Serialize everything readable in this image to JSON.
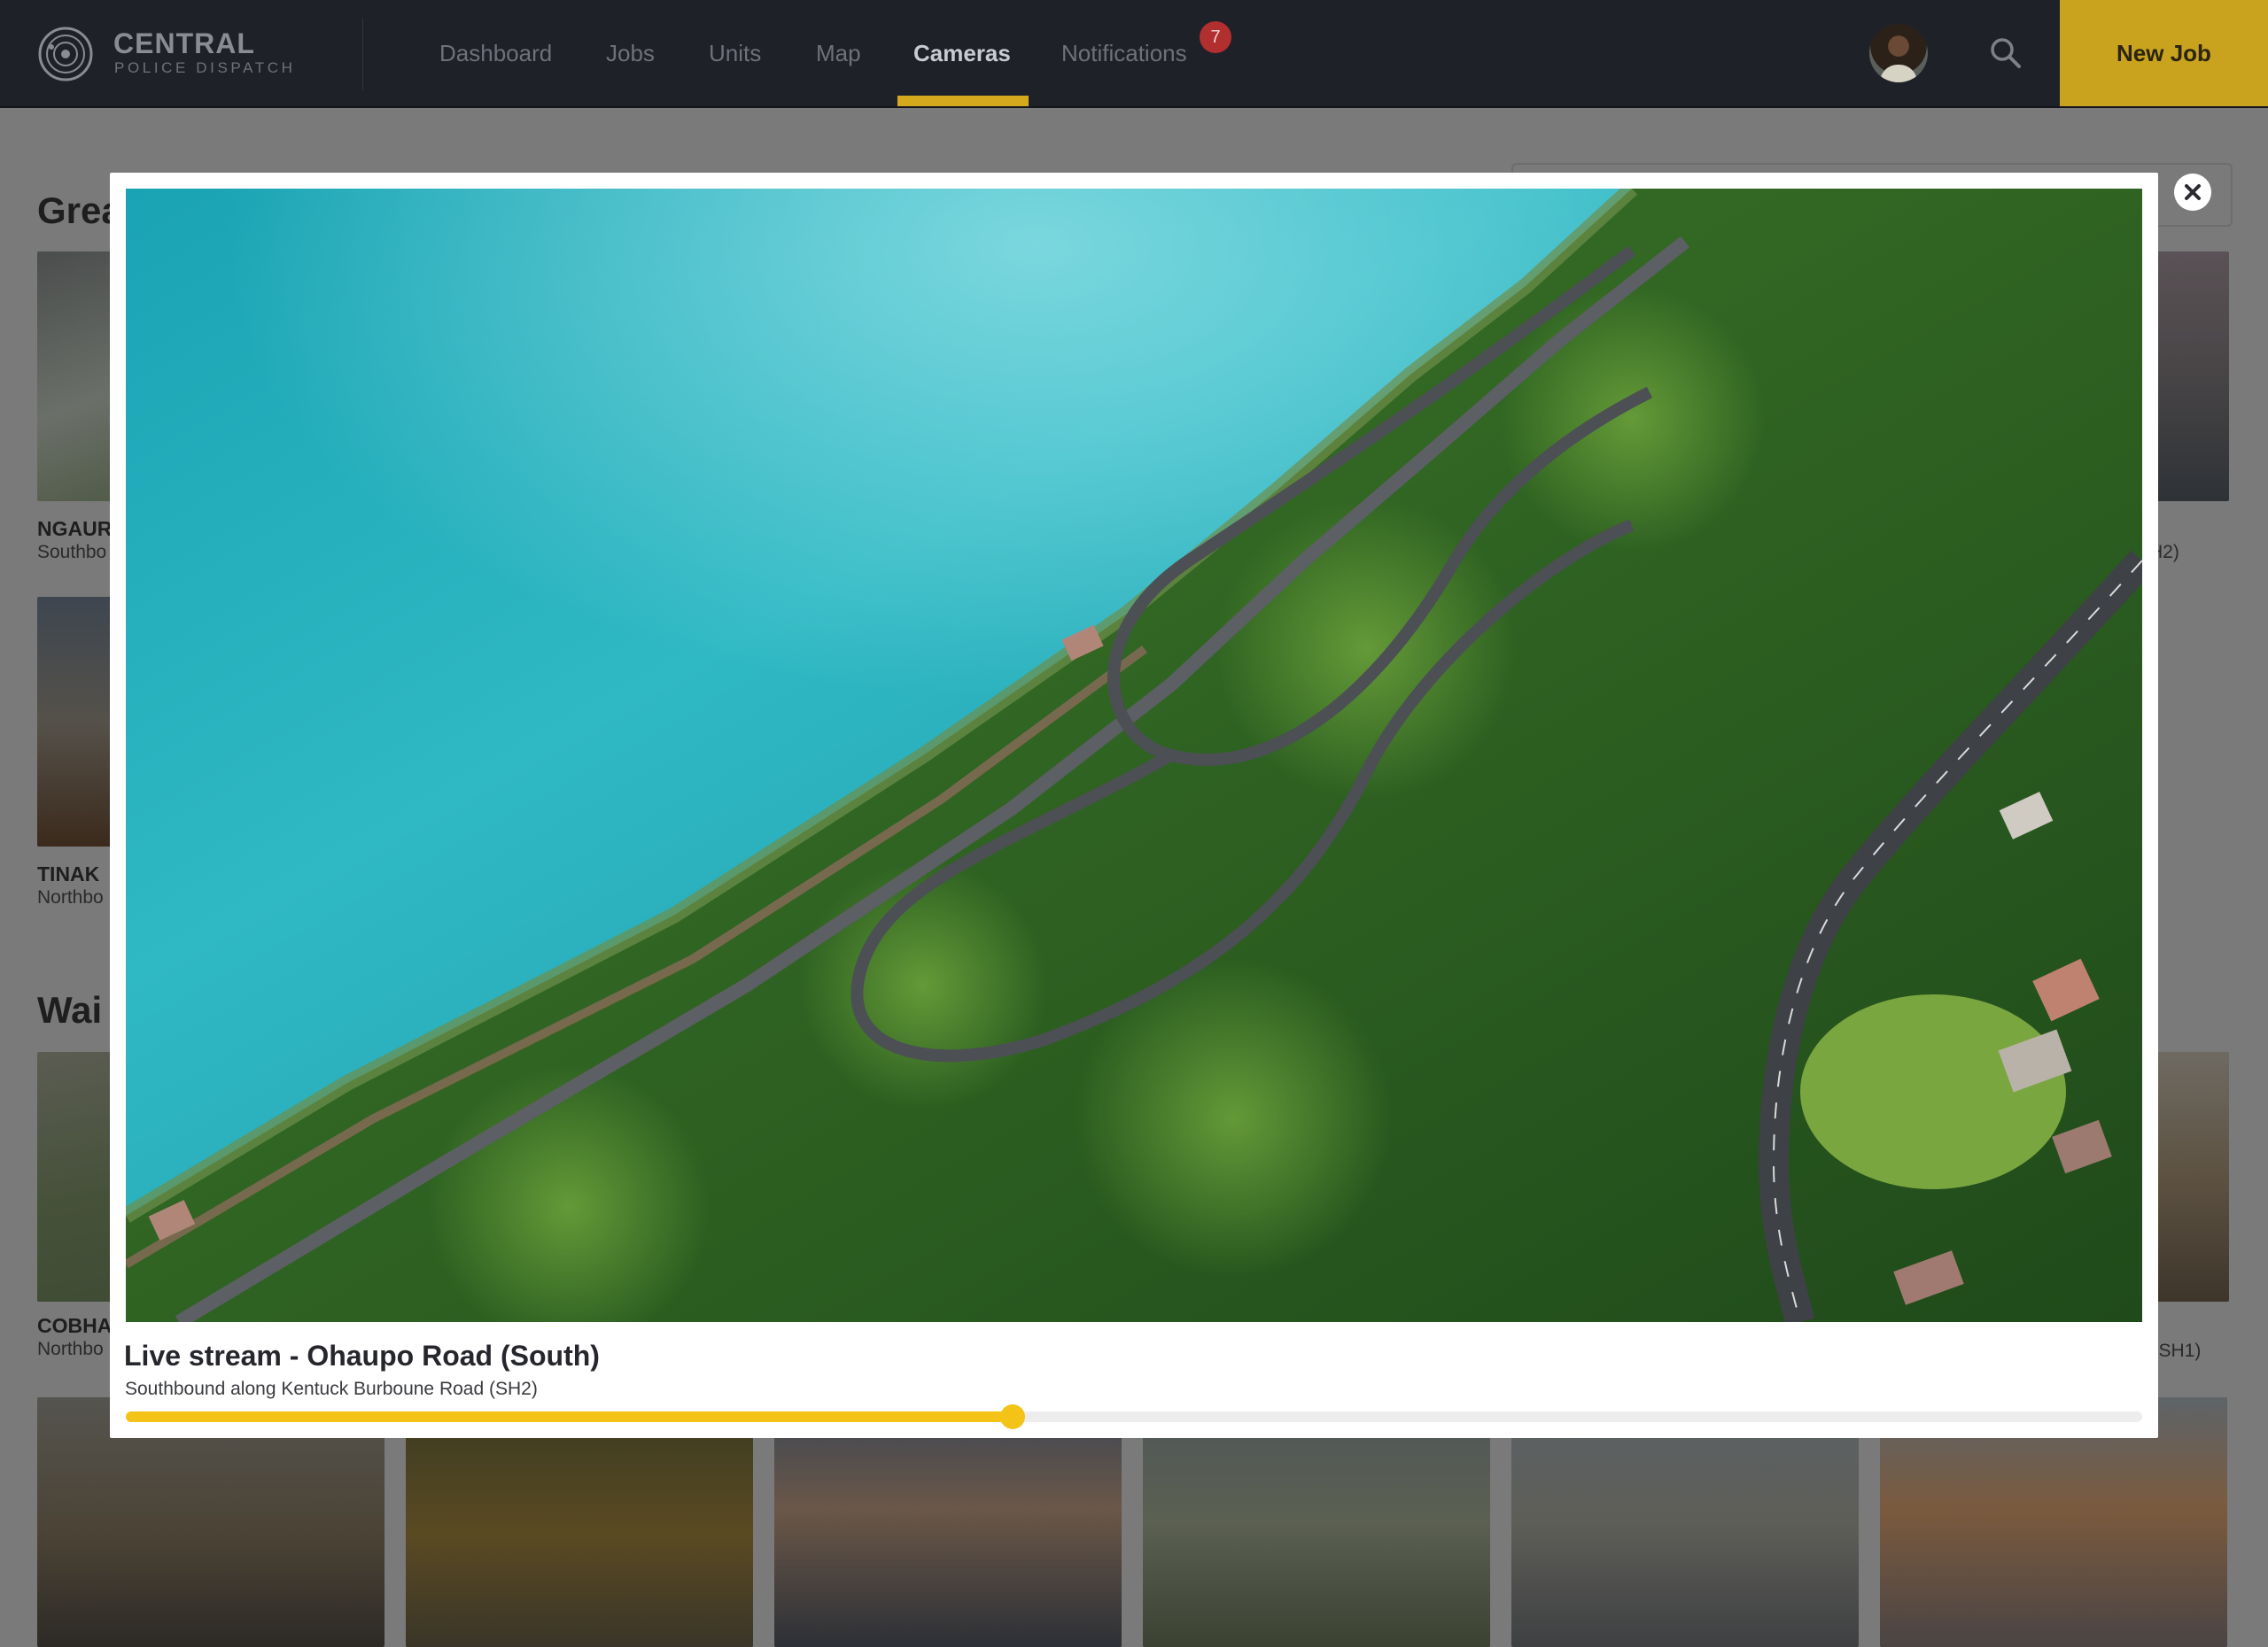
{
  "brand": {
    "title": "CENTRAL",
    "subtitle": "POLICE DISPATCH"
  },
  "nav": {
    "items": [
      {
        "label": "Dashboard"
      },
      {
        "label": "Jobs"
      },
      {
        "label": "Units"
      },
      {
        "label": "Map"
      },
      {
        "label": "Cameras",
        "active": true
      },
      {
        "label": "Notifications",
        "badge": "7"
      }
    ],
    "new_job_label": "New Job"
  },
  "page": {
    "sections": [
      {
        "title": "Grea"
      },
      {
        "title": "Wai"
      }
    ],
    "cameras": [
      {
        "name": "NGAUR",
        "desc": "Southbo"
      },
      {
        "name": "TINAK",
        "desc": "Northbo"
      },
      {
        "name": "COBHA",
        "desc": "Northbo"
      },
      {
        "desc": "H2)"
      },
      {
        "desc": "d (SH1)"
      }
    ]
  },
  "modal": {
    "title": "Live stream - Ohaupo Road (South)",
    "description": "Southbound along Kentuck Burboune Road (SH2)",
    "progress": 0.44
  },
  "colors": {
    "accent": "#f3c318",
    "nav_bg": "#1f2129",
    "badge": "#b22f2f",
    "new_job_bg": "#c9a21e"
  }
}
